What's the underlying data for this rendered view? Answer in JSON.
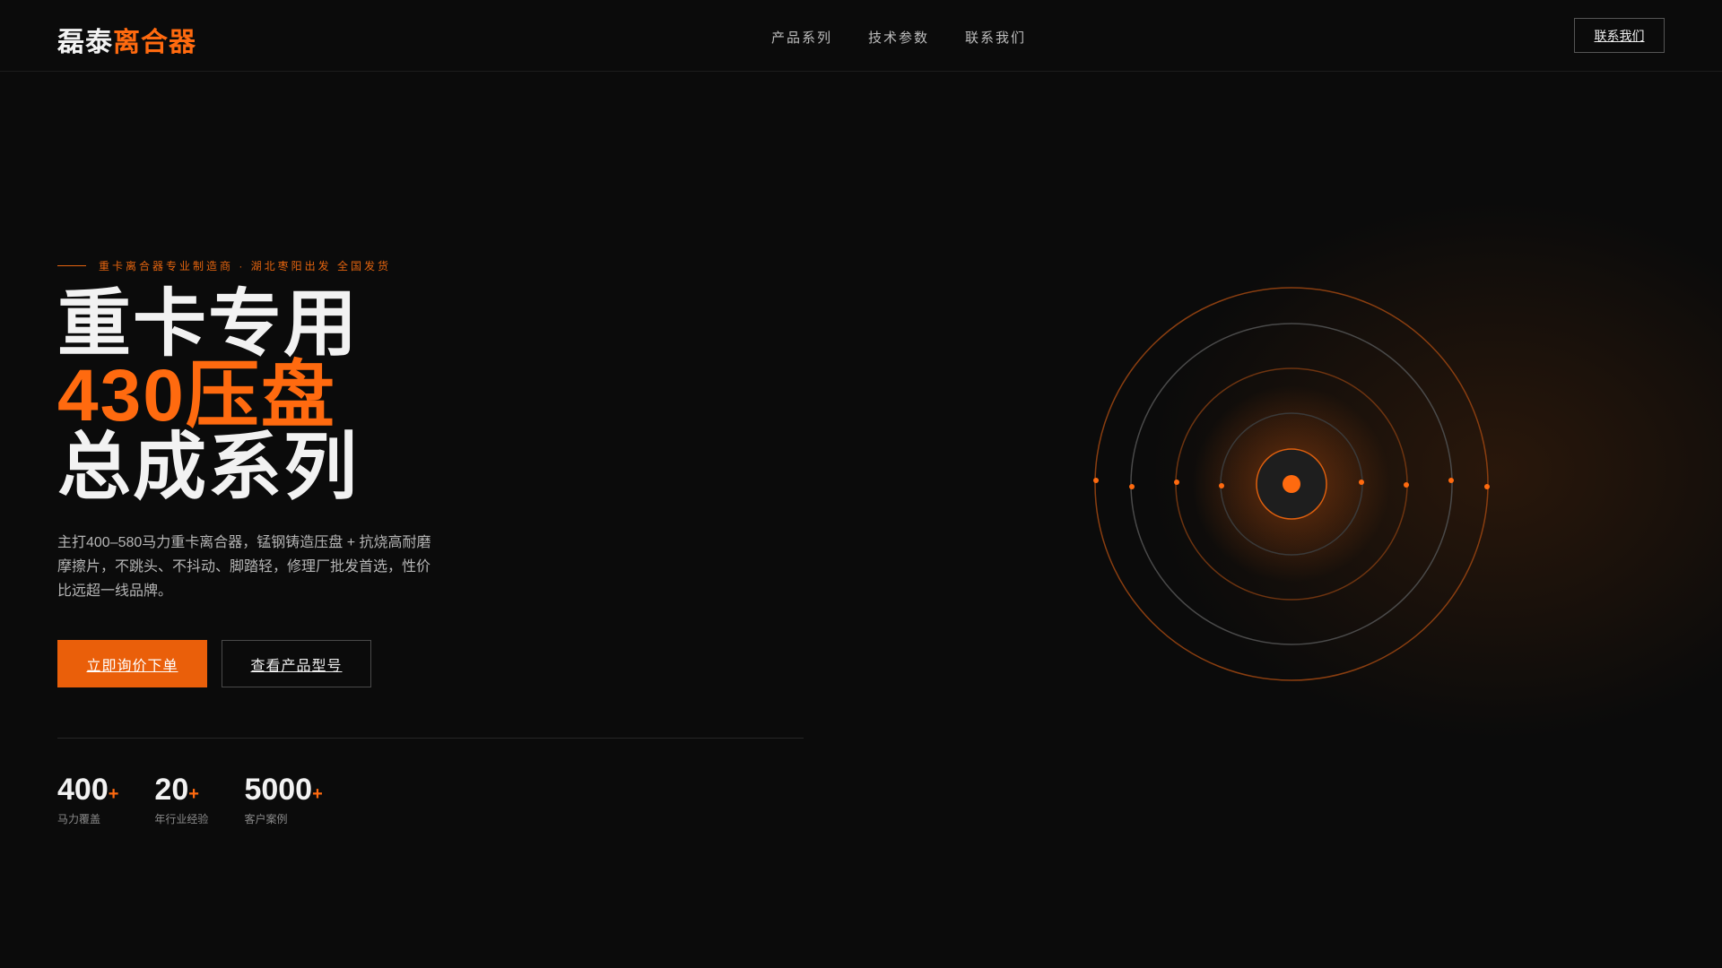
{
  "brand": {
    "part1": "磊泰",
    "part2": "离合器"
  },
  "nav": {
    "items": [
      "产品系列",
      "技术参数",
      "联系我们"
    ],
    "cta": "联系我们"
  },
  "hero": {
    "tagline": "重卡离合器专业制造商 · 湖北枣阳出发 全国发货",
    "title_line1": "重卡专用",
    "title_line2": "430压盘",
    "title_line3": "总成系列",
    "description": "主打400–580马力重卡离合器，锰钢铸造压盘 + 抗烧高耐磨摩擦片，不跳头、不抖动、脚踏轻，修理厂批发首选，性价比远超一线品牌。",
    "primary_button": "立即询价下单",
    "secondary_button": "查看产品型号"
  },
  "stats": [
    {
      "value": "400",
      "suffix": "+",
      "label": "马力覆盖"
    },
    {
      "value": "20",
      "suffix": "+",
      "label": "年行业经验"
    },
    {
      "value": "5000",
      "suffix": "+",
      "label": "客户案例"
    }
  ],
  "colors": {
    "accent": "#ff6a0f",
    "background": "#0b0b0b"
  }
}
